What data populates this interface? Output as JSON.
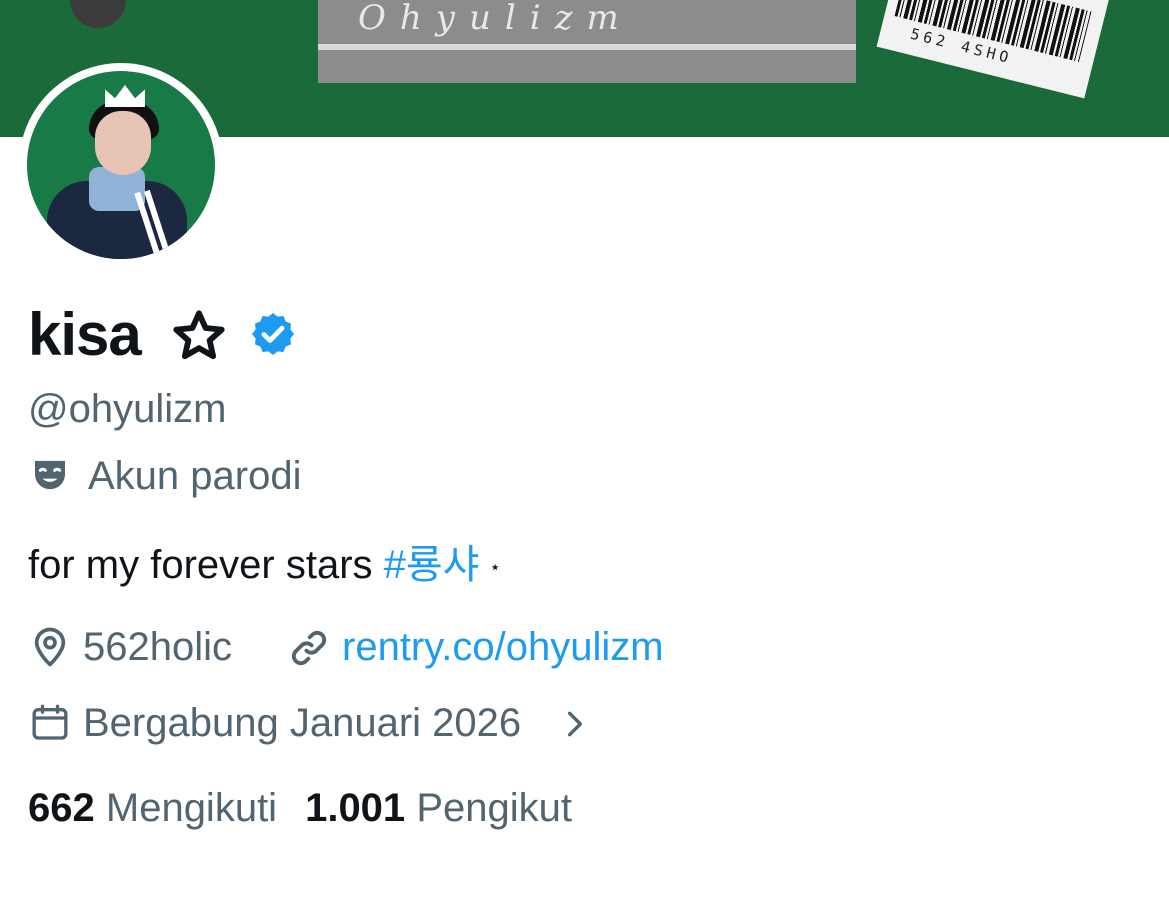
{
  "banner": {
    "card_text": "Ohyulizm",
    "barcode_text": "562 4SHO"
  },
  "profile": {
    "display_name": "kisa",
    "handle": "@ohyulizm",
    "parody_label": "Akun parodi",
    "bio_text": "for my forever stars ",
    "bio_hashtag": "#룡샤",
    "bio_sparkle": "⋆",
    "location": "562holic",
    "website": "rentry.co/ohyulizm",
    "joined": "Bergabung Januari 2026"
  },
  "stats": {
    "following_count": "662",
    "following_label": "Mengikuti",
    "followers_count": "1.001",
    "followers_label": "Pengikut"
  },
  "colors": {
    "accent": "#1d9bf0",
    "secondary_text": "#536471",
    "primary_text": "#0f1419",
    "banner_green": "#1b6b3a"
  },
  "icons": [
    "star-icon",
    "verified-badge-icon",
    "theater-mask-icon",
    "location-pin-icon",
    "link-icon",
    "calendar-icon",
    "chevron-right-icon"
  ]
}
